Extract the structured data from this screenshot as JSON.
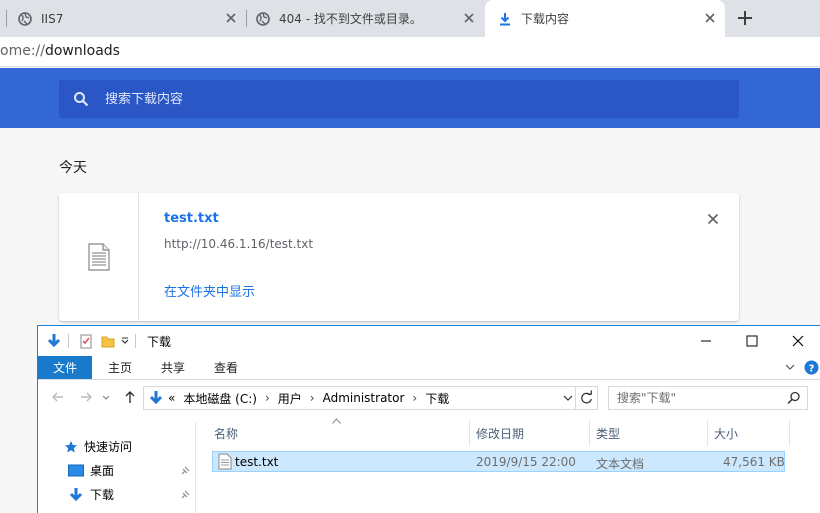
{
  "browser": {
    "tabs": [
      {
        "title": "IIS7"
      },
      {
        "title": "404 - 找不到文件或目录。"
      },
      {
        "title": "下载内容"
      }
    ],
    "url": {
      "scheme_visible": "ome://",
      "host": "downloads"
    }
  },
  "downloads": {
    "search_placeholder": "搜索下载内容",
    "date_heading": "今天",
    "item": {
      "file_name": "test.txt",
      "source_url": "http://10.46.1.16/test.txt",
      "show_in_folder": "在文件夹中显示"
    }
  },
  "explorer": {
    "title": "下载",
    "ribbon_tabs": [
      "文件",
      "主页",
      "共享",
      "查看"
    ],
    "address": {
      "overflow": "«",
      "crumbs": [
        "本地磁盘 (C:)",
        "用户",
        "Administrator",
        "下载"
      ]
    },
    "search_placeholder": "搜索\"下载\"",
    "nav": {
      "quick_access": "快速访问",
      "items": [
        "桌面",
        "下载"
      ]
    },
    "columns": [
      "名称",
      "修改日期",
      "类型",
      "大小"
    ],
    "rows": [
      {
        "name": "test.txt",
        "modified": "2019/9/15 22:00",
        "type": "文本文档",
        "size": "47,561 KB"
      }
    ],
    "colors": {
      "accent": "#1979ca",
      "selection": "#cce8ff"
    }
  },
  "colors": {
    "header_blue": "#3367d6",
    "link_blue": "#1a73e8"
  }
}
